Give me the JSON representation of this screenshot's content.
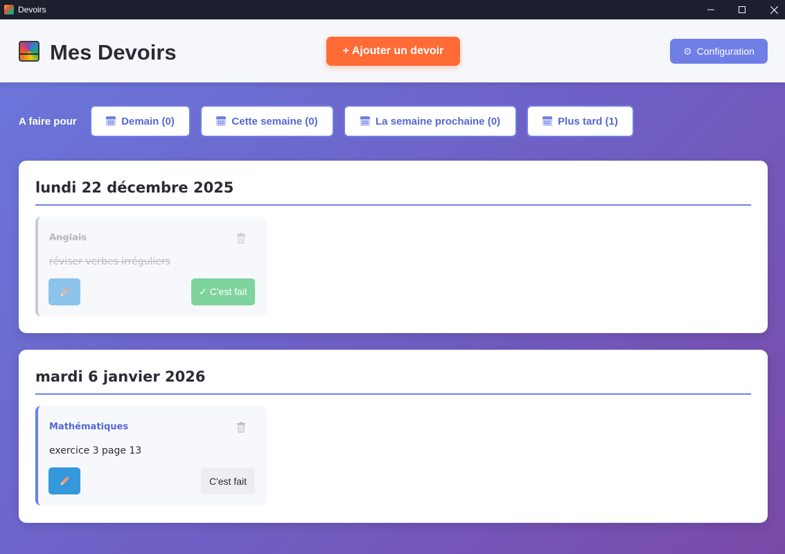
{
  "window": {
    "title": "Devoirs"
  },
  "header": {
    "title": "Mes Devoirs",
    "add_label": "+ Ajouter un devoir",
    "config_label": "Configuration"
  },
  "filters": {
    "label": "A faire pour",
    "items": [
      {
        "label": "Demain (0)"
      },
      {
        "label": "Cette semaine (0)"
      },
      {
        "label": "La semaine prochaine (0)"
      },
      {
        "label": "Plus tard (1)"
      }
    ]
  },
  "days": [
    {
      "date": "lundi 22 décembre 2025",
      "tasks": [
        {
          "subject": "Anglais",
          "description": "réviser verbes irréguliers",
          "done_label": "✓ C'est fait",
          "status": "done"
        }
      ]
    },
    {
      "date": "mardi 6 janvier 2026",
      "tasks": [
        {
          "subject": "Mathématiques",
          "description": "exercice 3 page 13",
          "done_label": "C'est fait",
          "status": "todo"
        }
      ]
    }
  ],
  "colors": {
    "accent": "#6f7fe6",
    "add_button": "#ff6b35",
    "edit_button": "#3498db",
    "done_button": "#7fd39d"
  },
  "icons": {
    "logo": "notebook-icon",
    "config": "gear-icon",
    "filter": "calendar-icon",
    "delete": "trash-icon",
    "edit": "pencil-icon"
  }
}
